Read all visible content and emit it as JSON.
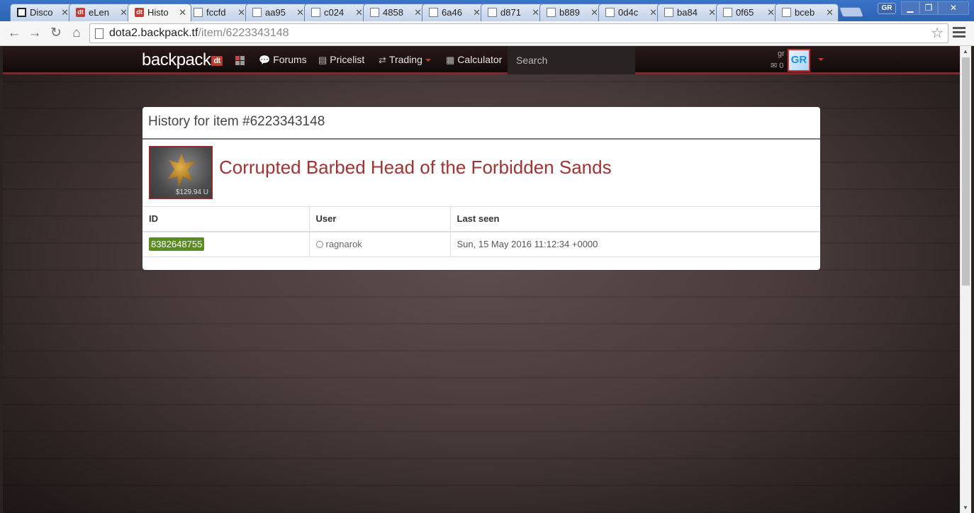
{
  "browser": {
    "tabs": [
      {
        "icon": "discord",
        "label": "Disco"
      },
      {
        "icon": "dt",
        "label": "eLen"
      },
      {
        "icon": "dt",
        "label": "Histo",
        "active": true
      },
      {
        "icon": "page",
        "label": "fccfd"
      },
      {
        "icon": "page",
        "label": "aa95"
      },
      {
        "icon": "page",
        "label": "c024"
      },
      {
        "icon": "page",
        "label": "4858"
      },
      {
        "icon": "page",
        "label": "6a46"
      },
      {
        "icon": "page",
        "label": "d871"
      },
      {
        "icon": "page",
        "label": "b889"
      },
      {
        "icon": "page",
        "label": "0d4c"
      },
      {
        "icon": "page",
        "label": "ba84"
      },
      {
        "icon": "page",
        "label": "0f65"
      },
      {
        "icon": "page",
        "label": "bceb"
      }
    ],
    "tab_close_glyph": "✕",
    "profile_badge": "GR",
    "url_host": "dota2.backpack.tf",
    "url_path": "/item/6223343148"
  },
  "site": {
    "brand": "backpack",
    "brand_badge": "dt",
    "nav": {
      "forums": "Forums",
      "pricelist": "Pricelist",
      "trading": "Trading",
      "calculator": "Calculator"
    },
    "search_placeholder": "Search",
    "user": {
      "name": "gr",
      "mail_count": "0",
      "avatar_text": "GR"
    }
  },
  "panel": {
    "title": "History for item #6223343148",
    "item_name": "Corrupted Barbed Head of the Forbidden Sands",
    "item_price": "$129.94",
    "item_price_suffix": "U",
    "table": {
      "headers": [
        "ID",
        "User",
        "Last seen"
      ],
      "rows": [
        {
          "id": "8382648755",
          "user": "ragnarok",
          "last_seen": "Sun, 15 May 2016 11:12:34 +0000"
        }
      ]
    }
  },
  "colors": {
    "item_name": "#a33232",
    "id_badge": "#5a8c1f",
    "nav_accent": "#7a2a2a"
  }
}
